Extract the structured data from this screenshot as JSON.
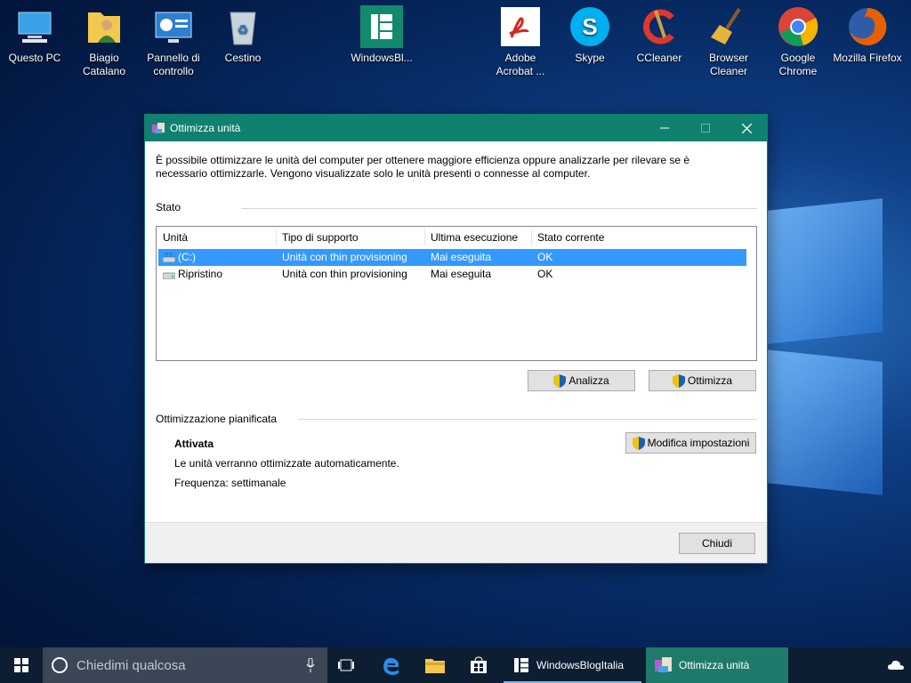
{
  "desktop": {
    "icons": [
      {
        "label": "Questo PC",
        "icon": "computer-icon"
      },
      {
        "label": "Biagio Catalano",
        "icon": "user-folder-icon"
      },
      {
        "label": "Pannello di controllo",
        "icon": "control-panel-icon"
      },
      {
        "label": "Cestino",
        "icon": "recycle-bin-icon"
      },
      {
        "label": "WindowsBl...",
        "icon": "windowsblog-icon"
      },
      {
        "label": "Adobe Acrobat ...",
        "icon": "acrobat-icon"
      },
      {
        "label": "Skype",
        "icon": "skype-icon"
      },
      {
        "label": "CCleaner",
        "icon": "ccleaner-icon"
      },
      {
        "label": "Browser Cleaner",
        "icon": "broom-icon"
      },
      {
        "label": "Google Chrome",
        "icon": "chrome-icon"
      },
      {
        "label": "Mozilla Firefox",
        "icon": "firefox-icon"
      }
    ]
  },
  "window": {
    "title": "Ottimizza unità",
    "intro": "È possibile ottimizzare le unità del computer per ottenere maggiore efficienza oppure analizzarle per rilevare se è necessario ottimizzarle. Vengono visualizzate solo le unità presenti o connesse al computer.",
    "status_label": "Stato",
    "columns": [
      "Unità",
      "Tipo di supporto",
      "Ultima esecuzione",
      "Stato corrente"
    ],
    "drives": [
      {
        "name": "(C:)",
        "type": "Unità con thin provisioning",
        "last_run": "Mai eseguita",
        "status": "OK",
        "selected": true
      },
      {
        "name": "Ripristino",
        "type": "Unità con thin provisioning",
        "last_run": "Mai eseguita",
        "status": "OK",
        "selected": false
      }
    ],
    "analyze_label": "Analizza",
    "optimize_label": "Ottimizza",
    "schedule_label": "Ottimizzazione pianificata",
    "schedule_state": "Attivata",
    "schedule_desc": "Le unità verranno ottimizzate automaticamente.",
    "schedule_freq": "Frequenza: settimanale",
    "change_settings_label": "Modifica impostazioni",
    "close_label": "Chiudi"
  },
  "taskbar": {
    "search_placeholder": "Chiedimi qualcosa",
    "tasks": [
      {
        "label": "WindowsBlogItalia",
        "active": false
      },
      {
        "label": "Ottimizza unità",
        "active": true
      }
    ]
  },
  "colors": {
    "titlebar": "#10806f",
    "selection": "#3399ff",
    "taskbar": "#0d1e33",
    "active_task": "#1f7a6b"
  }
}
